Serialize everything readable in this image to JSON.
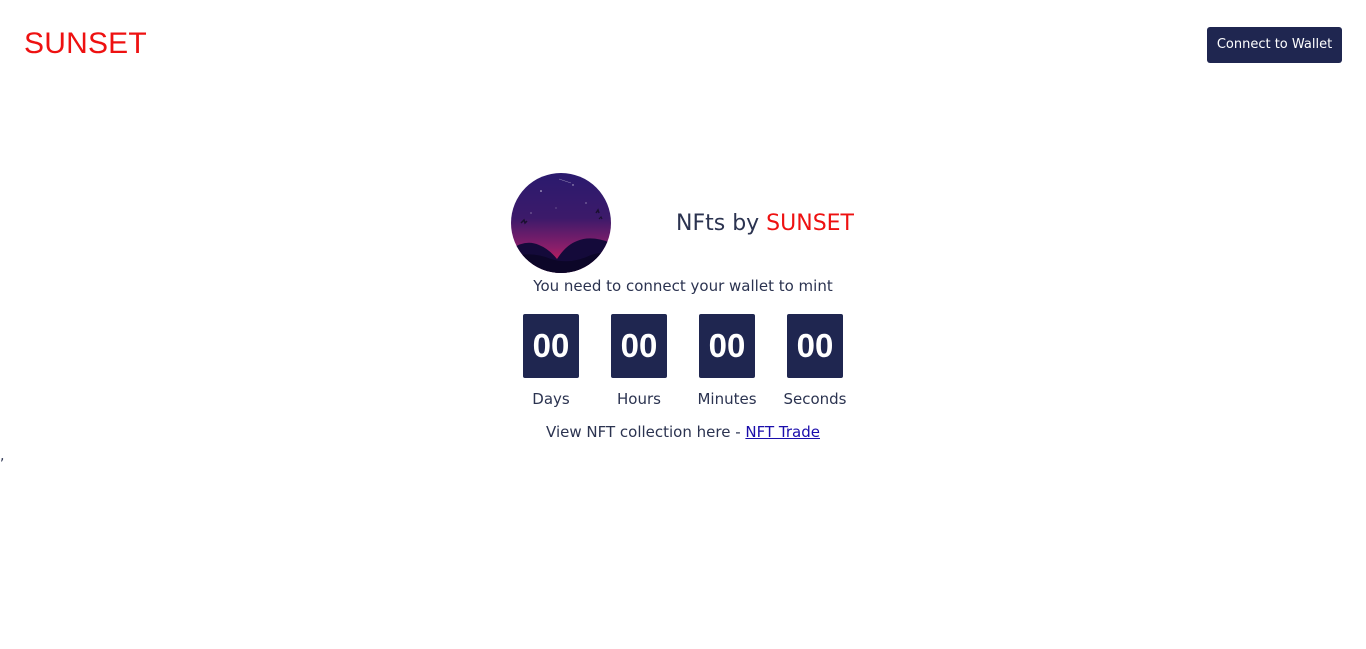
{
  "header": {
    "brand": "SUNSET",
    "connect_button": "Connect to Wallet"
  },
  "hero": {
    "avatar_icon": "sunset-mountain-illustration",
    "title_prefix": "NFts by ",
    "title_accent": "SUNSET",
    "notice": "You need to connect your wallet to mint"
  },
  "countdown": {
    "days": {
      "value": "00",
      "label": "Days"
    },
    "hours": {
      "value": "00",
      "label": "Hours"
    },
    "minutes": {
      "value": "00",
      "label": "Minutes"
    },
    "seconds": {
      "value": "00",
      "label": "Seconds"
    }
  },
  "collection": {
    "text": "View NFT collection here - ",
    "link_text": "NFT Trade"
  },
  "stray_text": ",",
  "colors": {
    "brand_red": "#ee1111",
    "navy": "#1f2650",
    "text": "#2b3350",
    "link": "#1a0dab"
  }
}
